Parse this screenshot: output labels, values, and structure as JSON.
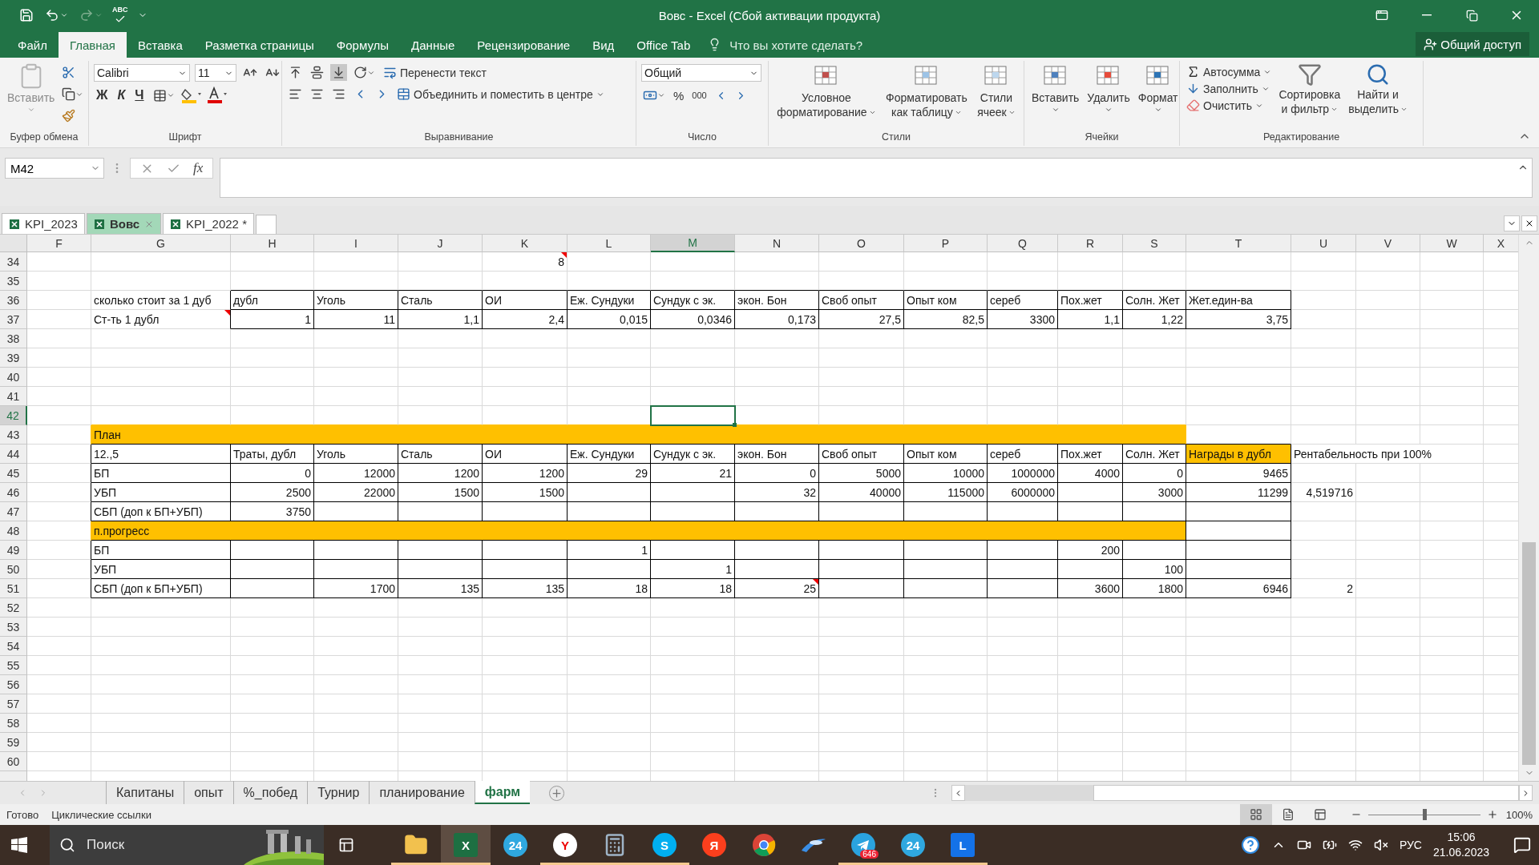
{
  "window": {
    "title": "Вовс - Excel (Сбой активации продукта)"
  },
  "qat": {
    "spell": "ABC",
    "redo_disabled": true
  },
  "menu": {
    "tabs": [
      {
        "label": "Файл",
        "selected": false
      },
      {
        "label": "Главная",
        "selected": true
      },
      {
        "label": "Вставка",
        "selected": false
      },
      {
        "label": "Разметка страницы",
        "selected": false
      },
      {
        "label": "Формулы",
        "selected": false
      },
      {
        "label": "Данные",
        "selected": false
      },
      {
        "label": "Рецензирование",
        "selected": false
      },
      {
        "label": "Вид",
        "selected": false
      },
      {
        "label": "Office Tab",
        "selected": false
      }
    ],
    "tell_me": "Что вы хотите сделать?",
    "share": "Общий доступ"
  },
  "ribbon": {
    "groups": [
      {
        "kind": "clipboard",
        "label": "Буфер обмена",
        "paste": {
          "label": "Вставить",
          "disabled": true
        }
      },
      {
        "kind": "font",
        "label": "Шрифт",
        "face": "Calibri",
        "size": "11",
        "bold": "Ж",
        "italic": "К",
        "underline": "Ч"
      },
      {
        "kind": "alignment",
        "label": "Выравнивание",
        "wrap": "Перенести текст",
        "merge": "Объединить и поместить в центре"
      },
      {
        "kind": "number",
        "label": "Число",
        "format": "Общий",
        "percent": "%",
        "thousands": "000"
      },
      {
        "kind": "styles",
        "label": "Стили",
        "buttons": [
          {
            "lines": [
              "Условное",
              "форматирование"
            ]
          },
          {
            "lines": [
              "Форматировать",
              "как таблицу"
            ]
          },
          {
            "lines": [
              "Стили",
              "ячеек"
            ]
          }
        ]
      },
      {
        "kind": "cells",
        "label": "Ячейки",
        "buttons": [
          {
            "lines": [
              "Вставить"
            ]
          },
          {
            "lines": [
              "Удалить"
            ]
          },
          {
            "lines": [
              "Формат"
            ]
          }
        ]
      },
      {
        "kind": "editing",
        "label": "Редактирование",
        "tools": [
          "Автосумма",
          "Заполнить",
          "Очистить"
        ],
        "buttons": [
          {
            "lines": [
              "Сортировка",
              "и фильтр"
            ]
          },
          {
            "lines": [
              "Найти и",
              "выделить"
            ]
          }
        ]
      }
    ]
  },
  "formula_bar": {
    "name_box": "M42",
    "fx": "fx"
  },
  "workbooks": [
    {
      "label": "KPI_2023",
      "selected": false
    },
    {
      "label": "Вовс",
      "selected": true
    },
    {
      "label": "KPI_2022 *",
      "selected": false
    }
  ],
  "grid": {
    "columns": [
      {
        "label": "F",
        "selected": false
      },
      {
        "label": "G",
        "selected": false
      },
      {
        "label": "H",
        "selected": false
      },
      {
        "label": "I",
        "selected": false
      },
      {
        "label": "J",
        "selected": false
      },
      {
        "label": "K",
        "selected": false
      },
      {
        "label": "L",
        "selected": false
      },
      {
        "label": "M",
        "selected": true
      },
      {
        "label": "N",
        "selected": false
      },
      {
        "label": "O",
        "selected": false
      },
      {
        "label": "P",
        "selected": false
      },
      {
        "label": "Q",
        "selected": false
      },
      {
        "label": "R",
        "selected": false
      },
      {
        "label": "S",
        "selected": false
      },
      {
        "label": "T",
        "selected": false
      },
      {
        "label": "U",
        "selected": false
      },
      {
        "label": "V",
        "selected": false
      },
      {
        "label": "W",
        "selected": false
      },
      {
        "label": "X",
        "selected": false
      }
    ],
    "rows": [
      {
        "number": "34",
        "kind": "blank",
        "selected": false,
        "cells": [
          null,
          null,
          null,
          null,
          null,
          {
            "text": "8",
            "kind": "number",
            "comment": true
          },
          null,
          null,
          null,
          null,
          null,
          null,
          null,
          null,
          null,
          null,
          null,
          null,
          null
        ]
      },
      {
        "number": "35",
        "kind": "blank",
        "selected": false
      },
      {
        "number": "36",
        "kind": "cost",
        "selected": false,
        "cells": [
          null,
          {
            "text": "сколько стоит за 1 дуб",
            "kind": "text",
            "comment": false
          },
          {
            "text": "дубл",
            "kind": "text",
            "comment": false
          },
          {
            "text": "Уголь",
            "kind": "text",
            "comment": false
          },
          {
            "text": "Сталь",
            "kind": "text",
            "comment": false
          },
          {
            "text": "ОИ",
            "kind": "text",
            "comment": false
          },
          {
            "text": "Еж. Сундуки",
            "kind": "text",
            "comment": false
          },
          {
            "text": "Сундук с эк.",
            "kind": "text",
            "comment": false
          },
          {
            "text": "экон. Бон",
            "kind": "text",
            "comment": false
          },
          {
            "text": "Своб опыт",
            "kind": "text",
            "comment": false
          },
          {
            "text": "Опыт ком",
            "kind": "text",
            "comment": false
          },
          {
            "text": "сереб",
            "kind": "text",
            "comment": false
          },
          {
            "text": "Пох.жет",
            "kind": "text",
            "comment": false
          },
          {
            "text": "Солн. Жет",
            "kind": "text",
            "comment": false
          },
          {
            "text": "Жет.един-ва",
            "kind": "text",
            "comment": false
          },
          null,
          null,
          null,
          null
        ]
      },
      {
        "number": "37",
        "kind": "cost",
        "selected": false,
        "cells": [
          null,
          {
            "text": "Ст-ть 1 дубл",
            "kind": "text",
            "comment": true
          },
          {
            "text": "1",
            "kind": "number",
            "comment": false
          },
          {
            "text": "11",
            "kind": "number",
            "comment": false
          },
          {
            "text": "1,1",
            "kind": "number",
            "comment": false
          },
          {
            "text": "2,4",
            "kind": "number",
            "comment": false
          },
          {
            "text": "0,015",
            "kind": "number",
            "comment": false
          },
          {
            "text": "0,0346",
            "kind": "number",
            "comment": false
          },
          {
            "text": "0,173",
            "kind": "number",
            "comment": false
          },
          {
            "text": "27,5",
            "kind": "number",
            "comment": false
          },
          {
            "text": "82,5",
            "kind": "number",
            "comment": false
          },
          {
            "text": "3300",
            "kind": "number",
            "comment": false
          },
          {
            "text": "1,1",
            "kind": "number",
            "comment": false
          },
          {
            "text": "1,22",
            "kind": "number",
            "comment": false
          },
          {
            "text": "3,75",
            "kind": "number",
            "comment": false
          },
          null,
          null,
          null,
          null
        ]
      },
      {
        "number": "38",
        "kind": "blank",
        "selected": false
      },
      {
        "number": "39",
        "kind": "blank",
        "selected": false
      },
      {
        "number": "40",
        "kind": "blank",
        "selected": false
      },
      {
        "number": "41",
        "kind": "blank",
        "selected": false
      },
      {
        "number": "42",
        "kind": "blank",
        "selected": true
      },
      {
        "number": "43",
        "kind": "band",
        "selected": false,
        "label": "План"
      },
      {
        "number": "44",
        "kind": "table",
        "selected": false,
        "cells": [
          null,
          {
            "text": "12.,5",
            "kind": "text",
            "comment": false
          },
          {
            "text": "Траты, дубл",
            "kind": "text",
            "comment": false
          },
          {
            "text": "Уголь",
            "kind": "text",
            "comment": false
          },
          {
            "text": "Сталь",
            "kind": "text",
            "comment": false
          },
          {
            "text": "ОИ",
            "kind": "text",
            "comment": false
          },
          {
            "text": "Еж. Сундуки",
            "kind": "text",
            "comment": false
          },
          {
            "text": "Сундук с эк.",
            "kind": "text",
            "comment": false
          },
          {
            "text": "экон. Бон",
            "kind": "text",
            "comment": false
          },
          {
            "text": "Своб опыт",
            "kind": "text",
            "comment": false
          },
          {
            "text": "Опыт ком",
            "kind": "text",
            "comment": false
          },
          {
            "text": "сереб",
            "kind": "text",
            "comment": false
          },
          {
            "text": "Пох.жет",
            "kind": "text",
            "comment": false
          },
          {
            "text": "Солн. Жет",
            "kind": "text",
            "comment": false
          },
          {
            "text": "Награды в дубл",
            "kind": "highlight",
            "comment": false
          },
          {
            "text": "Рентабельность при 100%",
            "kind": "text",
            "comment": false
          },
          null,
          null,
          null
        ]
      },
      {
        "number": "45",
        "kind": "table",
        "selected": false,
        "cells": [
          null,
          {
            "text": "БП",
            "kind": "text",
            "comment": false
          },
          {
            "text": "0",
            "kind": "number",
            "comment": false
          },
          {
            "text": "12000",
            "kind": "number",
            "comment": false
          },
          {
            "text": "1200",
            "kind": "number",
            "comment": false
          },
          {
            "text": "1200",
            "kind": "number",
            "comment": false
          },
          {
            "text": "29",
            "kind": "number",
            "comment": false
          },
          {
            "text": "21",
            "kind": "number",
            "comment": false
          },
          {
            "text": "0",
            "kind": "number",
            "comment": false
          },
          {
            "text": "5000",
            "kind": "number",
            "comment": false
          },
          {
            "text": "10000",
            "kind": "number",
            "comment": false
          },
          {
            "text": "1000000",
            "kind": "number",
            "comment": false
          },
          {
            "text": "4000",
            "kind": "number",
            "comment": false
          },
          {
            "text": "0",
            "kind": "number",
            "comment": false
          },
          {
            "text": "9465",
            "kind": "number",
            "comment": false
          },
          null,
          null,
          null,
          null
        ]
      },
      {
        "number": "46",
        "kind": "table",
        "selected": false,
        "cells": [
          null,
          {
            "text": "УБП",
            "kind": "text",
            "comment": false
          },
          {
            "text": "2500",
            "kind": "number",
            "comment": false
          },
          {
            "text": "22000",
            "kind": "number",
            "comment": false
          },
          {
            "text": "1500",
            "kind": "number",
            "comment": false
          },
          {
            "text": "1500",
            "kind": "number",
            "comment": false
          },
          null,
          null,
          {
            "text": "32",
            "kind": "number",
            "comment": false
          },
          {
            "text": "40000",
            "kind": "number",
            "comment": false
          },
          {
            "text": "115000",
            "kind": "number",
            "comment": false
          },
          {
            "text": "6000000",
            "kind": "number",
            "comment": false
          },
          null,
          {
            "text": "3000",
            "kind": "number",
            "comment": false
          },
          {
            "text": "11299",
            "kind": "number",
            "comment": false
          },
          {
            "text": "4,519716",
            "kind": "number",
            "comment": false
          },
          null,
          null,
          null
        ]
      },
      {
        "number": "47",
        "kind": "table",
        "selected": false,
        "cells": [
          null,
          {
            "text": "СБП (доп к БП+УБП)",
            "kind": "text",
            "comment": false
          },
          {
            "text": "3750",
            "kind": "number",
            "comment": false
          },
          null,
          null,
          null,
          null,
          null,
          null,
          null,
          null,
          null,
          null,
          null,
          null,
          null,
          null,
          null,
          null
        ]
      },
      {
        "number": "48",
        "kind": "bandbox",
        "selected": false,
        "label": "п.прогресс"
      },
      {
        "number": "49",
        "kind": "table",
        "selected": false,
        "cells": [
          null,
          {
            "text": "БП",
            "kind": "text",
            "comment": false
          },
          null,
          null,
          null,
          null,
          {
            "text": "1",
            "kind": "number",
            "comment": false
          },
          null,
          null,
          null,
          null,
          null,
          {
            "text": "200",
            "kind": "number",
            "comment": false
          },
          null,
          null,
          null,
          null,
          null,
          null
        ]
      },
      {
        "number": "50",
        "kind": "table",
        "selected": false,
        "cells": [
          null,
          {
            "text": "УБП",
            "kind": "text",
            "comment": false
          },
          null,
          null,
          null,
          null,
          null,
          {
            "text": "1",
            "kind": "number",
            "comment": false
          },
          null,
          null,
          null,
          null,
          null,
          {
            "text": "100",
            "kind": "number",
            "comment": false
          },
          null,
          null,
          null,
          null,
          null
        ]
      },
      {
        "number": "51",
        "kind": "table",
        "selected": false,
        "cells": [
          null,
          {
            "text": "СБП (доп к БП+УБП)",
            "kind": "text",
            "comment": false
          },
          null,
          {
            "text": "1700",
            "kind": "number",
            "comment": false
          },
          {
            "text": "135",
            "kind": "number",
            "comment": false
          },
          {
            "text": "135",
            "kind": "number",
            "comment": false
          },
          {
            "text": "18",
            "kind": "number",
            "comment": false
          },
          {
            "text": "18",
            "kind": "number",
            "comment": false
          },
          {
            "text": "25",
            "kind": "number",
            "comment": true
          },
          null,
          null,
          null,
          {
            "text": "3600",
            "kind": "number",
            "comment": false
          },
          {
            "text": "1800",
            "kind": "number",
            "comment": false
          },
          {
            "text": "6946",
            "kind": "number",
            "comment": false
          },
          {
            "text": "2",
            "kind": "number",
            "comment": false
          },
          null,
          null,
          null
        ]
      },
      {
        "number": "52",
        "kind": "blank",
        "selected": false
      },
      {
        "number": "53",
        "kind": "blank",
        "selected": false
      },
      {
        "number": "54",
        "kind": "blank",
        "selected": false
      },
      {
        "number": "55",
        "kind": "blank",
        "selected": false
      },
      {
        "number": "56",
        "kind": "blank",
        "selected": false
      },
      {
        "number": "57",
        "kind": "blank",
        "selected": false
      },
      {
        "number": "58",
        "kind": "blank",
        "selected": false
      },
      {
        "number": "59",
        "kind": "blank",
        "selected": false
      },
      {
        "number": "60",
        "kind": "blank",
        "selected": false
      }
    ]
  },
  "sheets": [
    {
      "label": "Капитаны",
      "selected": false
    },
    {
      "label": "опыт",
      "selected": false
    },
    {
      "label": "%_побед",
      "selected": false
    },
    {
      "label": "Турнир",
      "selected": false
    },
    {
      "label": "планирование",
      "selected": false
    },
    {
      "label": "фарм",
      "selected": true
    }
  ],
  "status": {
    "ready": "Готово",
    "circular": "Циклические ссылки",
    "views": [
      {
        "kind": "normal",
        "selected": true
      },
      {
        "kind": "layout",
        "selected": false
      },
      {
        "kind": "pagebreak",
        "selected": false
      }
    ],
    "zoom": {
      "level": 0.5,
      "reading": "100%"
    }
  },
  "taskbar": {
    "search_placeholder": "Поиск",
    "apps": [
      {
        "kind": "explorer",
        "running": true,
        "active": false
      },
      {
        "kind": "excel",
        "glyph": "X",
        "running": true,
        "active": true
      },
      {
        "kind": "bitrix",
        "glyph": "24",
        "running": false,
        "active": false
      },
      {
        "kind": "yabrowser",
        "glyph": "Y",
        "running": true,
        "active": false
      },
      {
        "kind": "calculator",
        "running": true,
        "active": false
      },
      {
        "kind": "skype",
        "glyph": "S",
        "running": true,
        "active": false
      },
      {
        "kind": "yandex",
        "glyph": "Я",
        "running": false,
        "active": false
      },
      {
        "kind": "chrome",
        "running": false,
        "active": false
      },
      {
        "kind": "swoosh",
        "running": false,
        "active": false
      },
      {
        "kind": "telegram",
        "badge": "646",
        "running": true,
        "active": false
      },
      {
        "kind": "bitrix",
        "glyph": "24",
        "running": true,
        "active": false
      },
      {
        "kind": "lapp",
        "glyph": "L",
        "running": true,
        "active": false
      }
    ],
    "language": "РУС",
    "time": "15:06",
    "date": "21.06.2023"
  }
}
